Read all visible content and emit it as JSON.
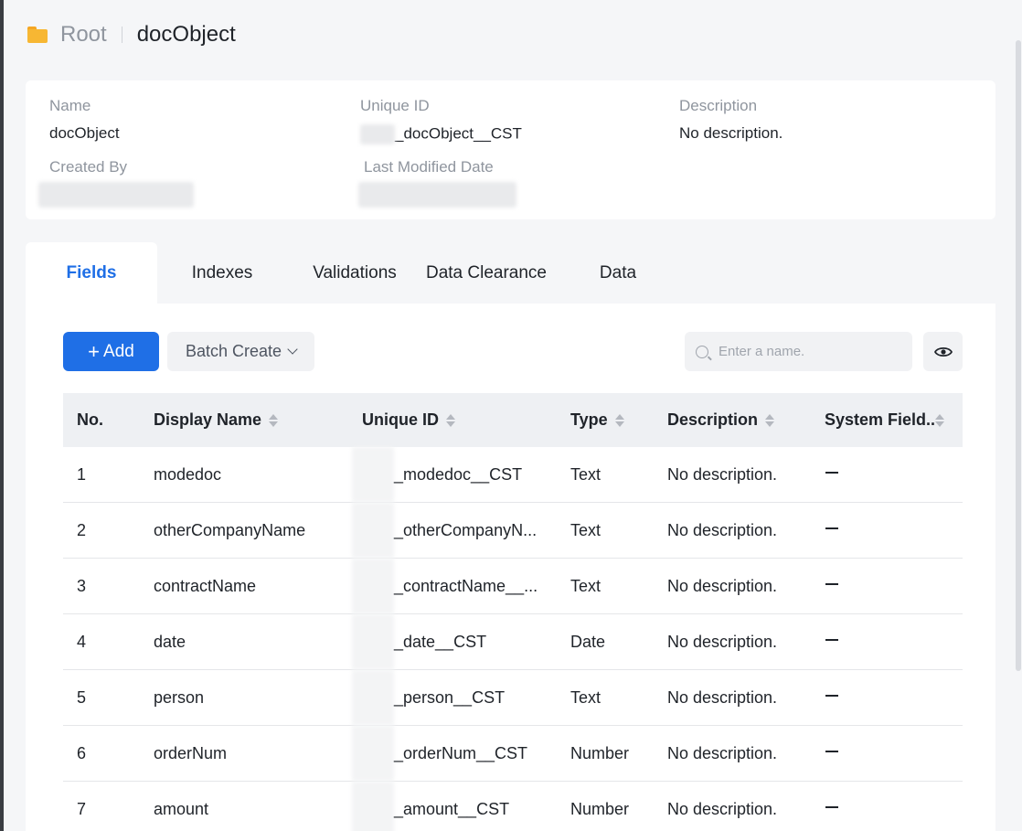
{
  "breadcrumb": {
    "root": "Root",
    "current": "docObject"
  },
  "info": {
    "name_label": "Name",
    "name_value": "docObject",
    "uid_label": "Unique ID",
    "uid_value": "_docObject__CST",
    "desc_label": "Description",
    "desc_value": "No description.",
    "created_label": "Created By",
    "modified_label": "Last Modified Date"
  },
  "tabs": [
    "Fields",
    "Indexes",
    "Validations",
    "Data Clearance",
    "Data"
  ],
  "toolbar": {
    "add_label": "Add",
    "batch_label": "Batch Create",
    "search_placeholder": "Enter a name."
  },
  "table": {
    "headers": [
      "No.",
      "Display Name",
      "Unique ID",
      "Type",
      "Description",
      "System Field.."
    ],
    "rows": [
      {
        "no": "1",
        "display": "modedoc",
        "uid": "_modedoc__CST",
        "type": "Text",
        "desc": "No description."
      },
      {
        "no": "2",
        "display": "otherCompanyName",
        "uid": "_otherCompanyN...",
        "type": "Text",
        "desc": "No description."
      },
      {
        "no": "3",
        "display": "contractName",
        "uid": "_contractName__...",
        "type": "Text",
        "desc": "No description."
      },
      {
        "no": "4",
        "display": "date",
        "uid": "_date__CST",
        "type": "Date",
        "desc": "No description."
      },
      {
        "no": "5",
        "display": "person",
        "uid": "_person__CST",
        "type": "Text",
        "desc": "No description."
      },
      {
        "no": "6",
        "display": "orderNum",
        "uid": "_orderNum__CST",
        "type": "Number",
        "desc": "No description."
      },
      {
        "no": "7",
        "display": "amount",
        "uid": "_amount__CST",
        "type": "Number",
        "desc": "No description."
      }
    ]
  },
  "colors": {
    "primary": "#1f6fe6",
    "folder": "#f7b733"
  }
}
